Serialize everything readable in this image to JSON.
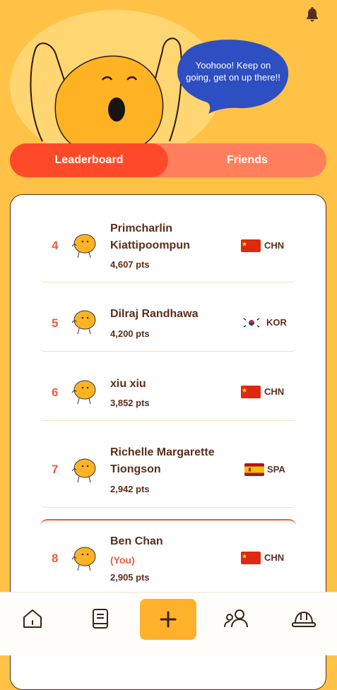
{
  "header": {
    "speech": "Yoohooo! Keep on going, get on up there!!"
  },
  "tabs": [
    {
      "label": "Leaderboard",
      "active": true
    },
    {
      "label": "Friends",
      "active": false
    }
  ],
  "leaderboard": [
    {
      "rank": "4",
      "name": "Primcharlin Kiattipoompun",
      "you": "",
      "points": "4,607 pts",
      "flag": "china-flag",
      "country": "CHN"
    },
    {
      "rank": "5",
      "name": "Dilraj Randhawa",
      "you": "",
      "points": "4,200 pts",
      "flag": "korea-flag",
      "country": "KOR"
    },
    {
      "rank": "6",
      "name": "xiu xiu",
      "you": "",
      "points": "3,852 pts",
      "flag": "china-flag",
      "country": "CHN"
    },
    {
      "rank": "7",
      "name": "Richelle Margarette Tiongson",
      "you": "",
      "points": "2,942 pts",
      "flag": "spain-flag",
      "country": "SPA"
    },
    {
      "rank": "8",
      "name": "Ben Chan",
      "you": "(You)",
      "points": "2,905 pts",
      "flag": "china-flag",
      "country": "CHN"
    }
  ],
  "nav": [
    {
      "icon": "home-icon"
    },
    {
      "icon": "book-icon"
    },
    {
      "icon": "plus-icon"
    },
    {
      "icon": "friends-icon"
    },
    {
      "icon": "hardhat-icon"
    }
  ],
  "colors": {
    "background": "#FFC247",
    "accent": "#FF4A2A",
    "rank": "#F05A3A",
    "text": "#5B2E1B",
    "bubble": "#2E4FC2"
  }
}
